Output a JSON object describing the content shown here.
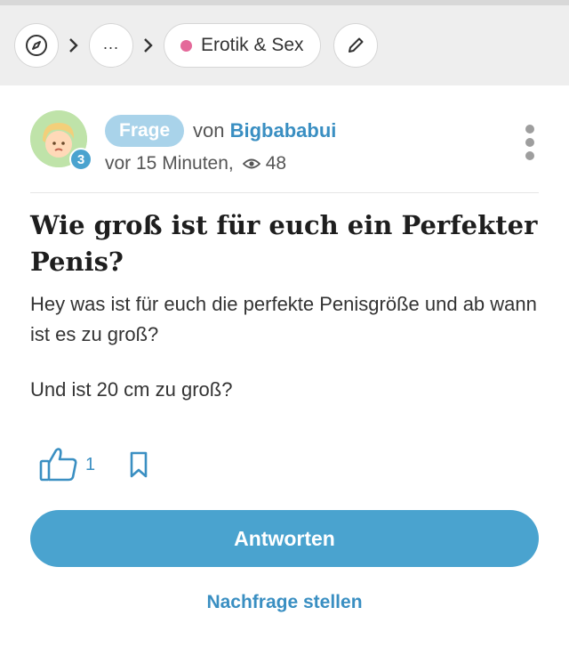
{
  "breadcrumb": {
    "ellipsis": "...",
    "category": "Erotik & Sex",
    "category_color": "#e4699a"
  },
  "icons": {
    "explore": "compass-icon",
    "separator": "chevron-right-icon",
    "edit": "pencil-icon",
    "views": "eye-icon",
    "more": "more-vertical-icon",
    "like": "thumbs-up-icon",
    "bookmark": "bookmark-icon"
  },
  "post": {
    "type_label": "Frage",
    "by_label": "von",
    "author": "Bigbababui",
    "author_level": "3",
    "time": "vor 15 Minuten,",
    "views": "48",
    "title": "Wie groß ist für euch ein Perfekter Penis?",
    "body": "Hey was ist für euch die perfekte Penisgröße und ab wann ist es zu groß?",
    "body2": "Und ist 20 cm zu groß?",
    "likes": "1"
  },
  "buttons": {
    "answer": "Antworten",
    "follow_up": "Nachfrage stellen"
  },
  "colors": {
    "accent": "#4aa3cf",
    "link": "#3a8fc2",
    "badge": "#a9d3ea"
  }
}
